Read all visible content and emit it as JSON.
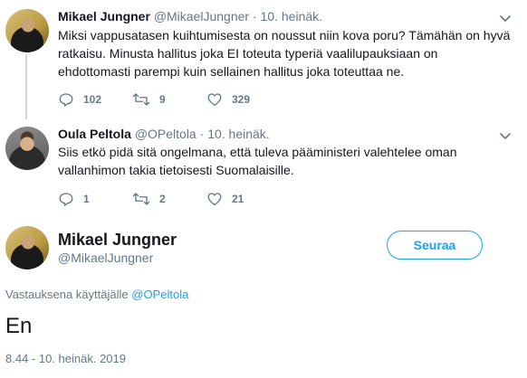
{
  "tweets": [
    {
      "name": "Mikael Jungner",
      "handle": "@MikaelJungner",
      "separator": "·",
      "date": "10. heinäk.",
      "lines": [
        "Miksi vappusatasen kuihtumisesta on noussut niin kova poru? Tämähän on hyvä",
        "ratkaisu. Minusta hallitus joka EI toteuta typeriä vaalilupauksiaan on",
        "ehdottomasti parempi kuin sellainen hallitus joka toteuttaa ne."
      ],
      "replies": "102",
      "retweets": "9",
      "likes": "329"
    },
    {
      "name": "Oula Peltola",
      "handle": "@OPeltola",
      "separator": "·",
      "date": "10. heinäk.",
      "lines": [
        "Siis etkö pidä sitä ongelmana, että tuleva pääministeri valehtelee oman",
        "vallanhimon takia tietoisesti Suomalaisille."
      ],
      "replies": "1",
      "retweets": "2",
      "likes": "21"
    }
  ],
  "main": {
    "name": "Mikael Jungner",
    "handle": "@MikaelJungner",
    "follow_label": "Seuraa",
    "reply_prefix": "Vastauksena käyttäjälle",
    "reply_mention": "@OPeltola",
    "text": "En",
    "timestamp": "8.44 - 10. heinäk. 2019"
  },
  "colors": {
    "accent": "#1da1f2",
    "muted": "#657786",
    "text": "#14171a",
    "thread_line": "#ccd6dd"
  },
  "icons": [
    "chevron-down-icon",
    "reply-icon",
    "retweet-icon",
    "like-icon"
  ]
}
